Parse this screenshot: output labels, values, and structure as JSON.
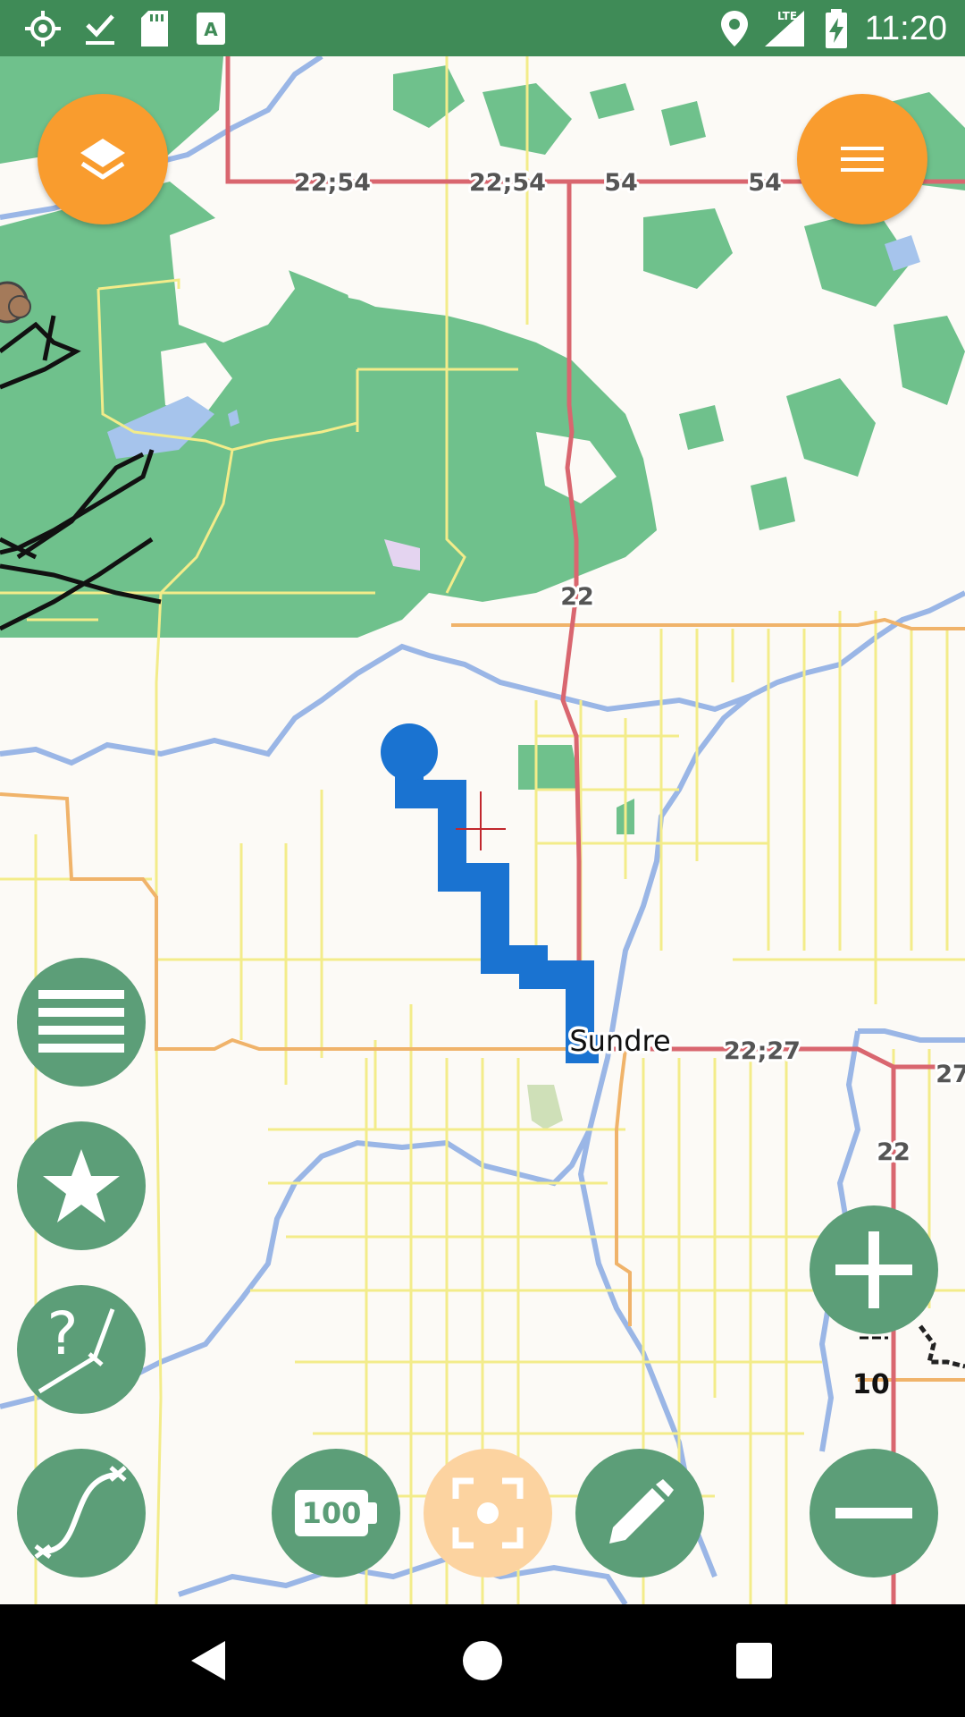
{
  "status_bar": {
    "time": "11:20",
    "network": "LTE",
    "icons": [
      "gps-icon",
      "download-done-icon",
      "sd-card-icon",
      "text-icon",
      "location-pin-icon",
      "signal-icon",
      "battery-charging-icon"
    ]
  },
  "map": {
    "place_label": "Sundre",
    "road_labels": [
      "22;54",
      "22;54",
      "54",
      "54",
      "22",
      "22;27",
      "27",
      "22"
    ],
    "scale_label": "10"
  },
  "buttons": {
    "layers": "layers-icon",
    "menu": "menu-icon",
    "list": "list-icon",
    "favorites": "star-icon",
    "route_help": "unknown-route-icon",
    "curve": "curve-icon",
    "battery_level": "100",
    "center": "focus-icon",
    "edit": "pencil-icon",
    "zoom_in": "plus-icon",
    "zoom_out": "minus-icon"
  },
  "colors": {
    "status_bar": "#3f8b57",
    "forest": "#6fc18c",
    "route": "#1a73d1",
    "fab_orange": "#f99c2e",
    "fab_green": "#5c9e78",
    "highway": "#d9666f",
    "secondary": "#f0b36a",
    "minor_road": "#f3ec8a",
    "water": "#9ab6e6"
  },
  "nav_bar": [
    "back-icon",
    "home-icon",
    "recents-icon"
  ]
}
